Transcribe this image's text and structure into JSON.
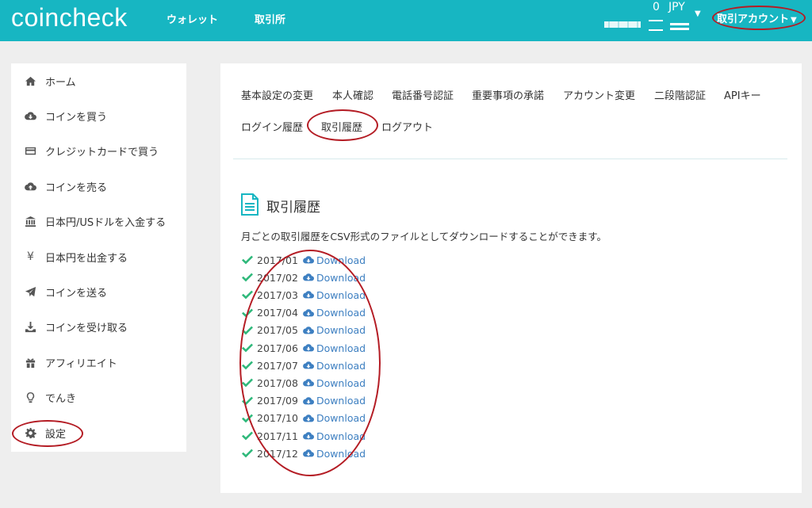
{
  "header": {
    "logo": "coincheck",
    "nav": [
      "ウォレット",
      "取引所"
    ],
    "balance_amount": "0",
    "balance_unit": "JPY",
    "account_label": "取引アカウント"
  },
  "sidebar": {
    "items": [
      {
        "label": "ホーム",
        "icon": "home-icon"
      },
      {
        "label": "コインを買う",
        "icon": "cloud-download-icon"
      },
      {
        "label": "クレジットカードで買う",
        "icon": "credit-card-icon"
      },
      {
        "label": "コインを売る",
        "icon": "cloud-upload-icon"
      },
      {
        "label": "日本円/USドルを入金する",
        "icon": "bank-icon"
      },
      {
        "label": "日本円を出金する",
        "icon": "yen-icon"
      },
      {
        "label": "コインを送る",
        "icon": "paper-plane-icon"
      },
      {
        "label": "コインを受け取る",
        "icon": "download-icon"
      },
      {
        "label": "アフィリエイト",
        "icon": "gift-icon"
      },
      {
        "label": "でんき",
        "icon": "lightbulb-icon"
      },
      {
        "label": "設定",
        "icon": "gear-icon"
      }
    ]
  },
  "tabs": [
    "基本設定の変更",
    "本人確認",
    "電話番号認証",
    "重要事項の承諾",
    "アカウント変更",
    "二段階認証",
    "APIキー",
    "ログイン履歴",
    "取引履歴",
    "ログアウト"
  ],
  "section": {
    "title": "取引履歴",
    "description": "月ごとの取引履歴をCSV形式のファイルとしてダウンロードすることができます。",
    "download_label": "Download",
    "months": [
      "2017/01",
      "2017/02",
      "2017/03",
      "2017/04",
      "2017/05",
      "2017/06",
      "2017/07",
      "2017/08",
      "2017/09",
      "2017/10",
      "2017/11",
      "2017/12"
    ]
  },
  "colors": {
    "header_bg": "#17b6c2",
    "link": "#3d7fc1",
    "check": "#2eb87a",
    "annotation": "#b41c24"
  }
}
